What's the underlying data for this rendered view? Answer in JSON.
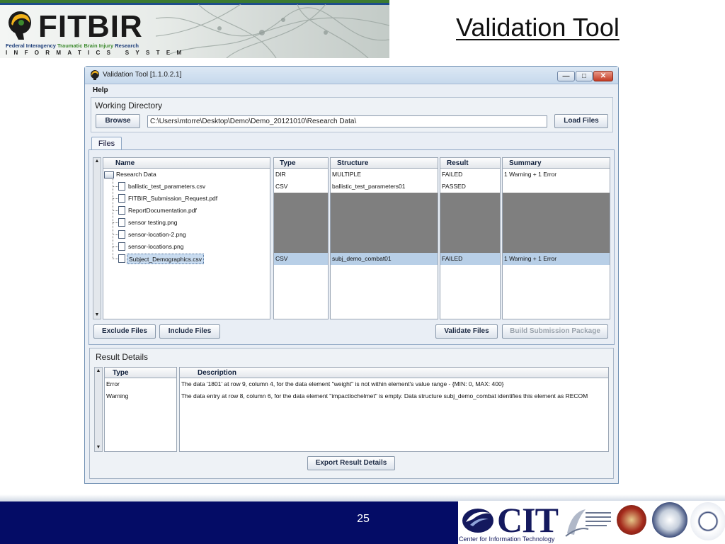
{
  "header": {
    "logo_text": "FITBIR",
    "logo_sub_a": "Federal Interagency ",
    "logo_sub_b": "Traumatic Brain Injury",
    "logo_sub_c": " Research",
    "logo_sub2": "INFORMATICS SYSTEM",
    "slide_title": "Validation Tool"
  },
  "window": {
    "title": "Validation Tool [1.1.0.2.1]",
    "menu_help": "Help",
    "working_directory_label": "Working Directory",
    "browse_label": "Browse",
    "path_value": "C:\\Users\\mtorre\\Desktop\\Demo\\Demo_20121010\\Research Data\\",
    "load_files_label": "Load Files",
    "tab_files": "Files",
    "columns": {
      "name": "Name",
      "type": "Type",
      "structure": "Structure",
      "result": "Result",
      "summary": "Summary"
    },
    "files": [
      {
        "name": "Research Data",
        "type": "DIR",
        "structure": "MULTIPLE",
        "result": "FAILED",
        "summary": "1 Warning + 1 Error"
      },
      {
        "name": "ballistic_test_parameters.csv",
        "type": "CSV",
        "structure": "ballistic_test_parameters01",
        "result": "PASSED",
        "summary": ""
      },
      {
        "name": "FITBIR_Submission_Request.pdf",
        "type": "",
        "structure": "",
        "result": "",
        "summary": ""
      },
      {
        "name": "ReportDocumentation.pdf",
        "type": "",
        "structure": "",
        "result": "",
        "summary": ""
      },
      {
        "name": "sensor testing.png",
        "type": "",
        "structure": "",
        "result": "",
        "summary": ""
      },
      {
        "name": "sensor-location-2.png",
        "type": "",
        "structure": "",
        "result": "",
        "summary": ""
      },
      {
        "name": "sensor-locations.png",
        "type": "",
        "structure": "",
        "result": "",
        "summary": ""
      },
      {
        "name": "Subject_Demographics.csv",
        "type": "CSV",
        "structure": "subj_demo_combat01",
        "result": "FAILED",
        "summary": "1 Warning + 1 Error"
      }
    ],
    "exclude_files_label": "Exclude Files",
    "include_files_label": "Include Files",
    "validate_files_label": "Validate Files",
    "build_package_label": "Build Submission Package",
    "result_details_label": "Result Details",
    "result_columns": {
      "type": "Type",
      "description": "Description"
    },
    "results": [
      {
        "type": "Error",
        "description": "The data '1801' at row 9, column 4, for the data element \"weight\" is not within element's value range - {MIN: 0, MAX: 400}"
      },
      {
        "type": "Warning",
        "description": "The data entry at row 8, column 6, for the data element \"impactlochelmet\" is empty. Data structure subj_demo_combat identifies this element as RECOM"
      }
    ],
    "export_label": "Export Result Details"
  },
  "footer": {
    "page_number": "25",
    "cit_text": "CIT",
    "cit_sub": "Center for Information Technology"
  }
}
